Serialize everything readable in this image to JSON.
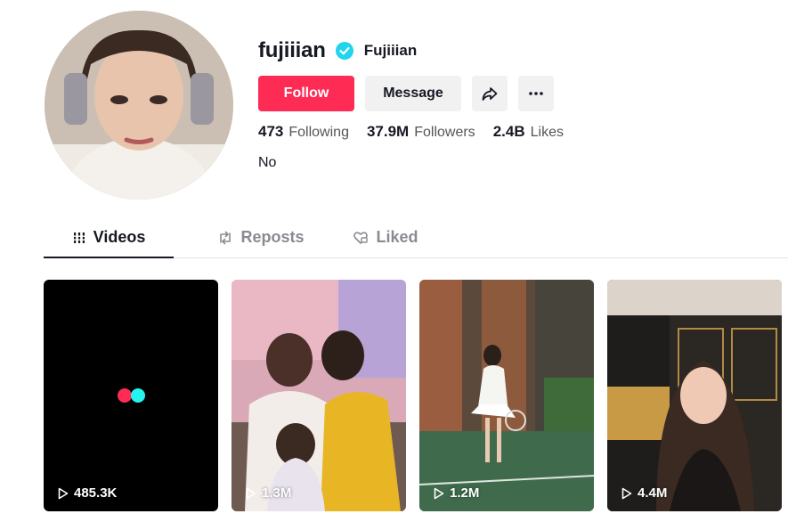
{
  "profile": {
    "username": "fujiiian",
    "nickname": "Fujiiian",
    "bio": "No"
  },
  "actions": {
    "follow_label": "Follow",
    "message_label": "Message"
  },
  "stats": [
    {
      "value": "473",
      "label": "Following"
    },
    {
      "value": "37.9M",
      "label": "Followers"
    },
    {
      "value": "2.4B",
      "label": "Likes"
    }
  ],
  "tabs": [
    {
      "label": "Videos",
      "icon": "grid-icon",
      "active": true
    },
    {
      "label": "Reposts",
      "icon": "repost-icon",
      "active": false
    },
    {
      "label": "Liked",
      "icon": "liked-heart-icon",
      "active": false
    }
  ],
  "videos": [
    {
      "views": "485.3K",
      "thumbnail": "loading-placeholder"
    },
    {
      "views": "1.3M",
      "thumbnail": "group-photo"
    },
    {
      "views": "1.2M",
      "thumbnail": "tennis-court"
    },
    {
      "views": "4.4M",
      "thumbnail": "selfie-room"
    }
  ],
  "colors": {
    "accent": "#fe2c55",
    "verified": "#20d5ec",
    "text": "#161823",
    "button_gray": "#f1f1f2"
  }
}
